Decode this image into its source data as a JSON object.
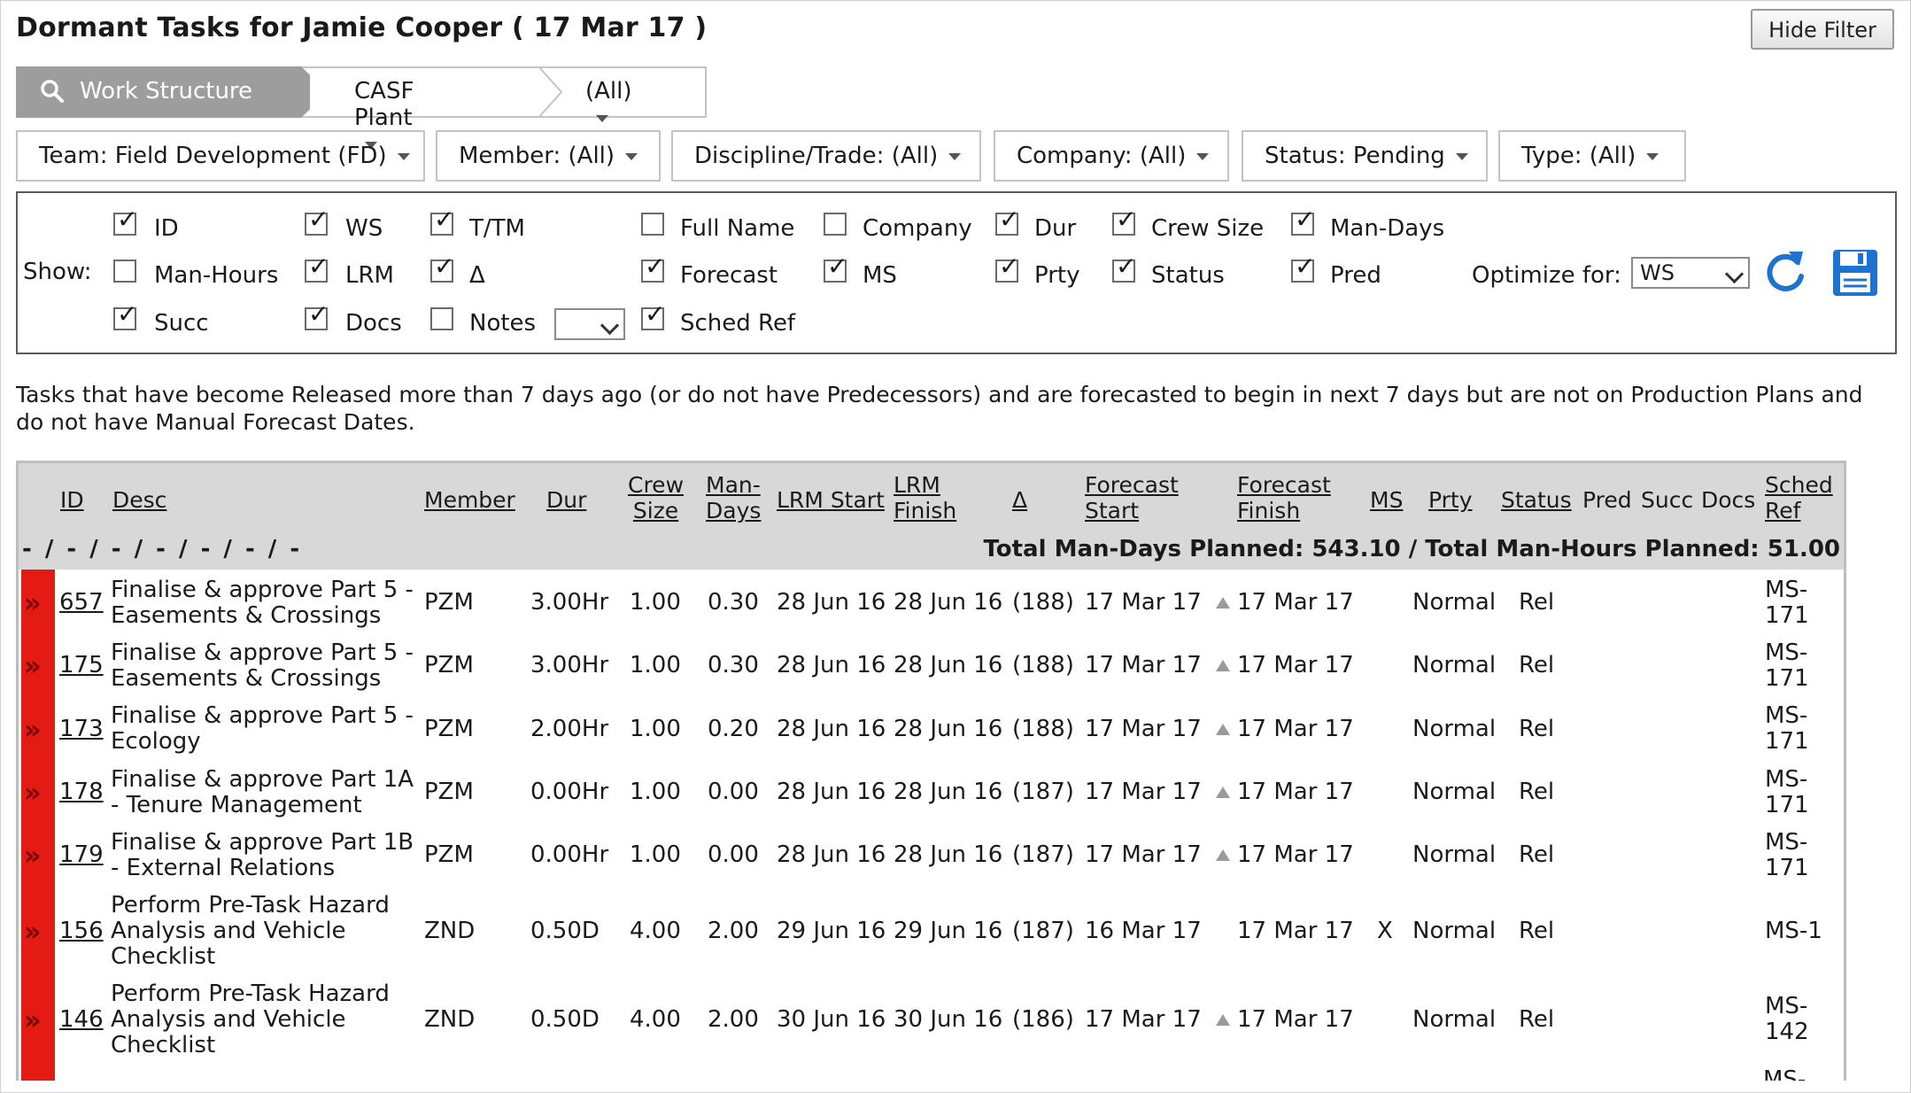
{
  "title": "Dormant Tasks for Jamie Cooper ( 17 Mar 17 )",
  "hide_filter_label": "Hide Filter",
  "breadcrumb": {
    "work_structure": "Work Structure",
    "plant": "CASF Plant",
    "all": "(All)"
  },
  "filters": [
    {
      "label": "Team:",
      "value": "Field Development (FD)"
    },
    {
      "label": "Member:",
      "value": "(All)"
    },
    {
      "label": "Discipline/Trade:",
      "value": "(All)"
    },
    {
      "label": "Company:",
      "value": "(All)"
    },
    {
      "label": "Status:",
      "value": "Pending"
    },
    {
      "label": "Type:",
      "value": "(All)"
    }
  ],
  "show": {
    "label": "Show:",
    "options": [
      {
        "label": "ID",
        "checked": true
      },
      {
        "label": "WS",
        "checked": true
      },
      {
        "label": "T/TM",
        "checked": true
      },
      {
        "label": "Full Name",
        "checked": false
      },
      {
        "label": "Company",
        "checked": false
      },
      {
        "label": "Dur",
        "checked": true
      },
      {
        "label": "Crew Size",
        "checked": true
      },
      {
        "label": "Man-Days",
        "checked": true
      },
      {
        "label": "Man-Hours",
        "checked": false
      },
      {
        "label": "LRM",
        "checked": true
      },
      {
        "label": "Δ",
        "checked": true
      },
      {
        "label": "Forecast",
        "checked": true
      },
      {
        "label": "MS",
        "checked": true
      },
      {
        "label": "Prty",
        "checked": true
      },
      {
        "label": "Status",
        "checked": true
      },
      {
        "label": "Pred",
        "checked": true
      },
      {
        "label": "Succ",
        "checked": true
      },
      {
        "label": "Docs",
        "checked": true
      },
      {
        "label": "Notes",
        "checked": false
      },
      {
        "label": "Sched Ref",
        "checked": true
      }
    ],
    "notes_select_value": "",
    "optimize_label": "Optimize for:",
    "optimize_value": "WS"
  },
  "description": "Tasks that have become Released more than 7 days ago (or do not have Predecessors) and are forecasted to begin in next 7 days but are not on Production Plans and do not have Manual Forecast Dates.",
  "table": {
    "headers": {
      "id": "ID",
      "desc": "Desc",
      "member": "Member",
      "dur": "Dur",
      "crew1": "Crew",
      "crew2": "Size",
      "man1": "Man-",
      "man2": "Days",
      "lrm_start": "LRM Start",
      "lrm_finish1": "LRM",
      "lrm_finish2": "Finish",
      "delta": "Δ",
      "fs1": "Forecast",
      "fs2": "Start",
      "ff1": "Forecast",
      "ff2": "Finish",
      "ms": "MS",
      "prty": "Prty",
      "status": "Status",
      "pred": "Pred",
      "succ": "Succ",
      "docs": "Docs",
      "sr1": "Sched",
      "sr2": "Ref"
    },
    "filter_dashes": "- / - / - / - / - / - / -",
    "totals": "Total Man-Days Planned: 543.10 / Total Man-Hours Planned: 51.00",
    "rows": [
      {
        "id": "657",
        "desc": [
          "Finalise & approve Part 5 -",
          "Easements & Crossings"
        ],
        "member": "PZM",
        "dur": "3.00Hr",
        "crew": "1.00",
        "man": "0.30",
        "lrm_start": "28 Jun 16",
        "lrm_finish": "28 Jun 16",
        "delta": "(188)",
        "fstart": "17 Mar 17",
        "ffinish": "17 Mar 17",
        "ms": "",
        "prty": "Normal",
        "status": "Rel",
        "ref": [
          "MS-",
          "171"
        ]
      },
      {
        "id": "175",
        "desc": [
          "Finalise & approve Part 5 -",
          "Easements & Crossings"
        ],
        "member": "PZM",
        "dur": "3.00Hr",
        "crew": "1.00",
        "man": "0.30",
        "lrm_start": "28 Jun 16",
        "lrm_finish": "28 Jun 16",
        "delta": "(188)",
        "fstart": "17 Mar 17",
        "ffinish": "17 Mar 17",
        "ms": "",
        "prty": "Normal",
        "status": "Rel",
        "ref": [
          "MS-",
          "171"
        ]
      },
      {
        "id": "173",
        "desc": [
          "Finalise & approve Part 5 -",
          "Ecology"
        ],
        "member": "PZM",
        "dur": "2.00Hr",
        "crew": "1.00",
        "man": "0.20",
        "lrm_start": "28 Jun 16",
        "lrm_finish": "28 Jun 16",
        "delta": "(188)",
        "fstart": "17 Mar 17",
        "ffinish": "17 Mar 17",
        "ms": "",
        "prty": "Normal",
        "status": "Rel",
        "ref": [
          "MS-",
          "171"
        ]
      },
      {
        "id": "178",
        "desc": [
          "Finalise & approve Part 1A",
          "- Tenure Management"
        ],
        "member": "PZM",
        "dur": "0.00Hr",
        "crew": "1.00",
        "man": "0.00",
        "lrm_start": "28 Jun 16",
        "lrm_finish": "28 Jun 16",
        "delta": "(187)",
        "fstart": "17 Mar 17",
        "ffinish": "17 Mar 17",
        "ms": "",
        "prty": "Normal",
        "status": "Rel",
        "ref": [
          "MS-",
          "171"
        ]
      },
      {
        "id": "179",
        "desc": [
          "Finalise & approve Part 1B",
          "- External Relations"
        ],
        "member": "PZM",
        "dur": "0.00Hr",
        "crew": "1.00",
        "man": "0.00",
        "lrm_start": "28 Jun 16",
        "lrm_finish": "28 Jun 16",
        "delta": "(187)",
        "fstart": "17 Mar 17",
        "ffinish": "17 Mar 17",
        "ms": "",
        "prty": "Normal",
        "status": "Rel",
        "ref": [
          "MS-",
          "171"
        ]
      },
      {
        "id": "156",
        "desc": [
          "Perform Pre-Task Hazard",
          "Analysis and Vehicle",
          "Checklist"
        ],
        "member": "ZND",
        "dur": "0.50D",
        "crew": "4.00",
        "man": "2.00",
        "lrm_start": "29 Jun 16",
        "lrm_finish": "29 Jun 16",
        "delta": "(187)",
        "fstart": "16 Mar 17",
        "ffinish": "17 Mar 17",
        "ms": "X",
        "prty": "Normal",
        "status": "Rel",
        "ref": [
          "MS-1"
        ]
      },
      {
        "id": "146",
        "desc": [
          "Perform Pre-Task Hazard",
          "Analysis and Vehicle",
          "Checklist"
        ],
        "member": "ZND",
        "dur": "0.50D",
        "crew": "4.00",
        "man": "2.00",
        "lrm_start": "30 Jun 16",
        "lrm_finish": "30 Jun 16",
        "delta": "(186)",
        "fstart": "17 Mar 17",
        "ffinish": "17 Mar 17",
        "ms": "",
        "prty": "Normal",
        "status": "Rel",
        "ref": [
          "MS-",
          "142"
        ]
      }
    ],
    "partial_row_ref": "MS-"
  },
  "colors": {
    "accent": "#1e73d2",
    "flag": "#e41b13",
    "header_bg": "#d8d8d8"
  }
}
